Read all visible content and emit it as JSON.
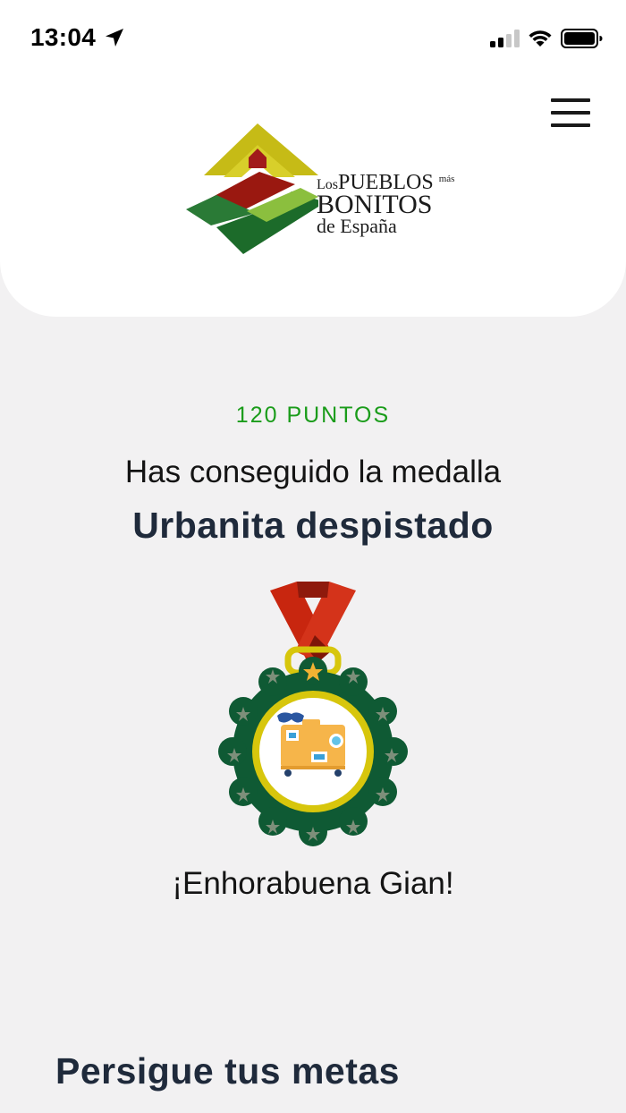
{
  "status_bar": {
    "time": "13:04",
    "icons": [
      "location-arrow-icon",
      "cellular-signal-icon",
      "wifi-icon",
      "battery-icon"
    ]
  },
  "header": {
    "logo": {
      "line1_prefix": "Los",
      "line1_main": "PUEBLOS",
      "line1_suffix": "más",
      "line2": "BONITOS",
      "line3": "de España"
    },
    "menu_icon": "hamburger-menu-icon"
  },
  "achievement": {
    "points": "120 PUNTOS",
    "subtitle": "Has conseguido la medalla",
    "medal_name": "Urbanita despistado",
    "medal_icon": "suitcase-medal-icon",
    "congrats": "¡Enhorabuena Gian!"
  },
  "goals": {
    "title": "Persigue tus metas"
  },
  "colors": {
    "background": "#f2f1f2",
    "header_bg": "#ffffff",
    "points_green": "#1a9c1a",
    "title_navy": "#1f2a3b",
    "medal_green": "#0f5a34",
    "medal_yellow": "#d7c60c",
    "ribbon_red": "#c8260f",
    "suitcase_orange": "#f6b54a"
  }
}
